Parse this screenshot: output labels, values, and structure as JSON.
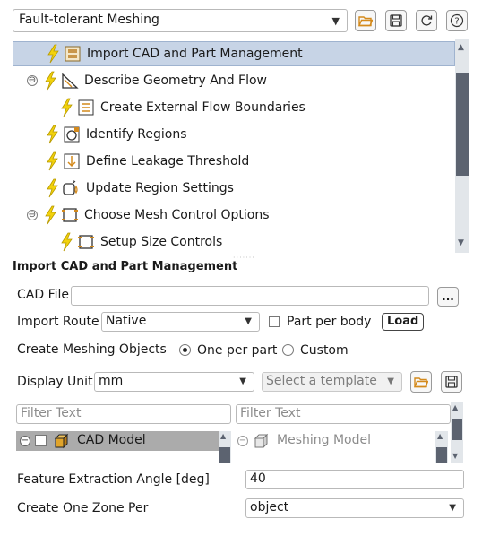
{
  "workflow_select": {
    "value": "Fault-tolerant Meshing"
  },
  "toolbar_icons": [
    "open-folder-icon",
    "save-icon",
    "refresh-icon",
    "help-icon"
  ],
  "tree": {
    "items": [
      {
        "label": "Import CAD and Part Management",
        "icon": "import-cad-icon"
      },
      {
        "label": "Describe Geometry And Flow",
        "icon": "geometry-icon",
        "expander": "⊖"
      },
      {
        "label": "Create External Flow Boundaries",
        "icon": "flow-boundary-icon"
      },
      {
        "label": "Identify Regions",
        "icon": "regions-icon"
      },
      {
        "label": "Define Leakage Threshold",
        "icon": "leakage-icon"
      },
      {
        "label": "Update Region Settings",
        "icon": "region-settings-icon"
      },
      {
        "label": "Choose Mesh Control Options",
        "icon": "mesh-control-icon",
        "expander": "⊖"
      },
      {
        "label": "Setup Size Controls",
        "icon": "size-controls-icon"
      }
    ]
  },
  "panel": {
    "title": "Import CAD and Part Management",
    "cad_file": {
      "label": "CAD File",
      "value": "",
      "browse_label": "..."
    },
    "import_route": {
      "label": "Import Route",
      "value": "Native"
    },
    "part_per_body": {
      "label": "Part per body",
      "checked": false
    },
    "load_label": "Load",
    "meshing_objects": {
      "label": "Create Meshing Objects",
      "options": [
        "One per part",
        "Custom"
      ],
      "selected": "One per part"
    },
    "display_unit": {
      "label": "Display Unit",
      "value": "mm"
    },
    "template": {
      "placeholder": "Select a template"
    },
    "filter_left": {
      "placeholder": "Filter Text"
    },
    "filter_right": {
      "placeholder": "Filter Text"
    },
    "cad_model_label": "CAD Model",
    "meshing_model_label": "Meshing Model",
    "feature_angle": {
      "label": "Feature Extraction Angle [deg]",
      "value": "40"
    },
    "zone_per": {
      "label": "Create One Zone Per",
      "value": "object"
    }
  },
  "colors": {
    "bolt": "#f2d20c",
    "selection": "#c7d4e6",
    "scroll_thumb": "#5c6370"
  }
}
